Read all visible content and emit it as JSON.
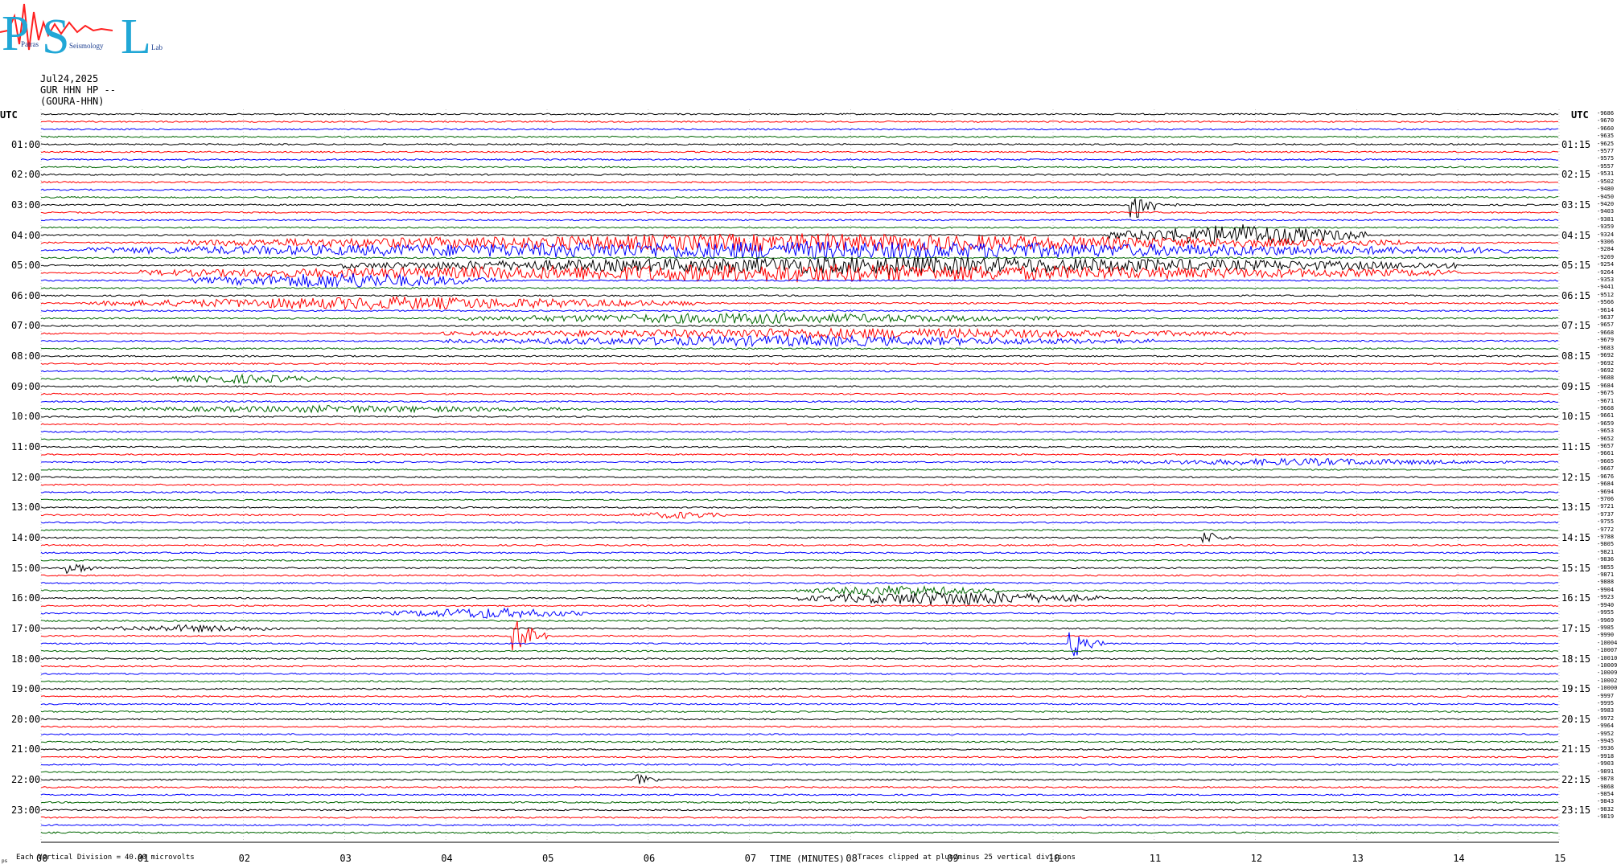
{
  "logo": {
    "letters": "PSL",
    "words": [
      "Patras",
      "Seismology",
      "Lab"
    ]
  },
  "header": {
    "date": "Jul24,2025",
    "station": "GUR HHN HP --",
    "site": "(GOURA-HHN)"
  },
  "axis_label_left": "UTC",
  "axis_label_right": "UTC",
  "colors": {
    "cycle": [
      "#000000",
      "#ff0000",
      "#0000ff",
      "#006600"
    ]
  },
  "chart_data": {
    "type": "line",
    "subtype": "helicorder",
    "xlabel": "TIME (MINUTES)",
    "x_ticks": [
      "00",
      "01",
      "02",
      "03",
      "04",
      "05",
      "06",
      "07",
      "08",
      "09",
      "10",
      "11",
      "12",
      "13",
      "14",
      "15"
    ],
    "xlim": [
      0,
      15
    ],
    "rows": 96,
    "minutes_per_row": 15,
    "left_hour_labels": [
      "01:00",
      "02:00",
      "03:00",
      "04:00",
      "05:00",
      "06:00",
      "07:00",
      "08:00",
      "09:00",
      "10:00",
      "11:00",
      "12:00",
      "13:00",
      "14:00",
      "15:00",
      "16:00",
      "17:00",
      "18:00",
      "19:00",
      "20:00",
      "21:00",
      "22:00",
      "23:00"
    ],
    "right_hour_labels": [
      "01:15",
      "02:15",
      "03:15",
      "04:15",
      "05:15",
      "06:15",
      "07:15",
      "08:15",
      "09:15",
      "10:15",
      "11:15",
      "12:15",
      "13:15",
      "14:15",
      "15:15",
      "16:15",
      "17:15",
      "18:15",
      "19:15",
      "20:15",
      "21:15",
      "22:15",
      "23:15"
    ],
    "row_offsets": [
      "-9686",
      "-9670",
      "-9660",
      "-9635",
      "-9625",
      "-9577",
      "-9575",
      "-9557",
      "-9531",
      "-9502",
      "-9480",
      "-9450",
      "-9420",
      "-9403",
      "-9381",
      "-9359",
      "-9324",
      "-9306",
      "-9284",
      "-9269",
      "-9254",
      "-9264",
      "-9353",
      "-9441",
      "-9512",
      "-9566",
      "-9614",
      "-9637",
      "-9657",
      "-9668",
      "-9679",
      "-9683",
      "-9692",
      "-9692",
      "-9692",
      "-9688",
      "-9684",
      "-9675",
      "-9671",
      "-9668",
      "-9661",
      "-9659",
      "-9653",
      "-9652",
      "-9657",
      "-9661",
      "-9665",
      "-9667",
      "-9676",
      "-9684",
      "-9694",
      "-9706",
      "-9721",
      "-9737",
      "-9755",
      "-9772",
      "-9788",
      "-9805",
      "-9821",
      "-9836",
      "-9855",
      "-9871",
      "-9888",
      "-9904",
      "-9923",
      "-9940",
      "-9955",
      "-9969",
      "-9985",
      "-9990",
      "-10004",
      "-10007",
      "-10010",
      "-10009",
      "-10009",
      "-10002",
      "-10000",
      "-9997",
      "-9995",
      "-9983",
      "-9972",
      "-9964",
      "-9952",
      "-9945",
      "-9936",
      "-9918",
      "-9903",
      "-9891",
      "-9878",
      "-9868",
      "-9854",
      "-9843",
      "-9832",
      "-9819"
    ],
    "events": [
      {
        "row": 12,
        "minute": 10.8,
        "amplitude": 5,
        "duration_min": 0.5
      },
      {
        "row": 16,
        "minute": 10.6,
        "amplitude": 3,
        "duration_min": 2.5
      },
      {
        "row": 17,
        "minute": 1.5,
        "amplitude": 2.5,
        "duration_min": 12
      },
      {
        "row": 18,
        "minute": 0.5,
        "amplitude": 2.5,
        "duration_min": 14
      },
      {
        "row": 20,
        "minute": 3.0,
        "amplitude": 2.5,
        "duration_min": 11
      },
      {
        "row": 21,
        "minute": 1.0,
        "amplitude": 2.5,
        "duration_min": 13
      },
      {
        "row": 22,
        "minute": 1.5,
        "amplitude": 2.2,
        "duration_min": 3
      },
      {
        "row": 25,
        "minute": 0.5,
        "amplitude": 1.8,
        "duration_min": 6
      },
      {
        "row": 27,
        "minute": 4.0,
        "amplitude": 1.5,
        "duration_min": 6
      },
      {
        "row": 29,
        "minute": 4.0,
        "amplitude": 1.5,
        "duration_min": 8
      },
      {
        "row": 30,
        "minute": 4.0,
        "amplitude": 1.5,
        "duration_min": 7
      },
      {
        "row": 35,
        "minute": 1.0,
        "amplitude": 1.2,
        "duration_min": 2
      },
      {
        "row": 39,
        "minute": 0.5,
        "amplitude": 1.0,
        "duration_min": 5
      },
      {
        "row": 46,
        "minute": 10.5,
        "amplitude": 1.0,
        "duration_min": 4
      },
      {
        "row": 53,
        "minute": 5.8,
        "amplitude": 1.0,
        "duration_min": 1
      },
      {
        "row": 56,
        "minute": 11.5,
        "amplitude": 2.0,
        "duration_min": 0.3
      },
      {
        "row": 60,
        "minute": 0.3,
        "amplitude": 2.0,
        "duration_min": 0.3
      },
      {
        "row": 63,
        "minute": 7.5,
        "amplitude": 1.5,
        "duration_min": 2
      },
      {
        "row": 64,
        "minute": 7.5,
        "amplitude": 2.0,
        "duration_min": 3
      },
      {
        "row": 66,
        "minute": 3.4,
        "amplitude": 1.5,
        "duration_min": 2
      },
      {
        "row": 68,
        "minute": 0.5,
        "amplitude": 1.0,
        "duration_min": 2
      },
      {
        "row": 69,
        "minute": 4.7,
        "amplitude": 5,
        "duration_min": 0.3
      },
      {
        "row": 70,
        "minute": 10.2,
        "amplitude": 4,
        "duration_min": 0.3
      },
      {
        "row": 88,
        "minute": 5.9,
        "amplitude": 1.5,
        "duration_min": 0.2
      }
    ]
  },
  "footer": {
    "division_label": "Each Vertical Division =",
    "division_value": "40.00 microvolts",
    "clip_note": "Traces clipped at plus/minus 25 vertical divisions",
    "corner": "ps"
  }
}
